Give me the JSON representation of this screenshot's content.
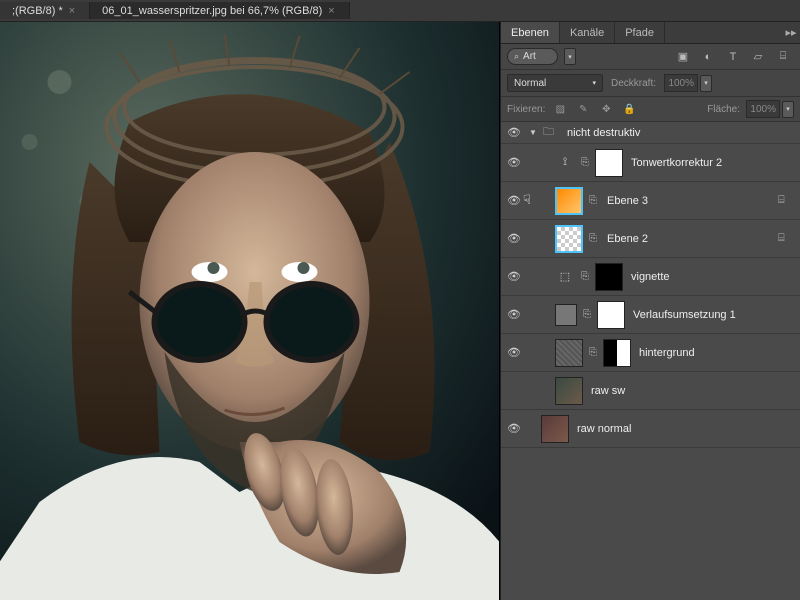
{
  "tabs": [
    {
      "label": ";(RGB/8) *",
      "close": "×",
      "active": false
    },
    {
      "label": "06_01_wasserspritzer.jpg bei 66,7% (RGB/8)",
      "close": "×",
      "active": true
    }
  ],
  "panel": {
    "tabs": {
      "ebenen": "Ebenen",
      "kanaele": "Kanäle",
      "pfade": "Pfade"
    },
    "search": {
      "icon": "⌕",
      "value": "Art"
    },
    "filter_icons": {
      "image": "▣",
      "adjust": "◐",
      "type": "T",
      "shape": "▱",
      "smart": "⌸"
    },
    "blend": {
      "mode": "Normal",
      "opacity_label": "Deckkraft:",
      "opacity_value": "100%"
    },
    "lock": {
      "label": "Fixieren:",
      "fill_label": "Fläche:",
      "fill_value": "100%"
    }
  },
  "group": {
    "name": "nicht destruktiv"
  },
  "layers": [
    {
      "id": "tonwert",
      "name": "Tonwertkorrektur 2",
      "adj_icon": "⟟",
      "mask": "white",
      "linked": true
    },
    {
      "id": "ebene3",
      "name": "Ebene 3",
      "thumb": "orange",
      "linked": true,
      "smart": true,
      "hand": true
    },
    {
      "id": "ebene2",
      "name": "Ebene 2",
      "thumb": "checker",
      "linked": true,
      "smart": true
    },
    {
      "id": "vignette",
      "name": "vignette",
      "adj_icon": "⬚",
      "mask": "black",
      "linked": true
    },
    {
      "id": "verlauf",
      "name": "Verlaufsumsetzung 1",
      "adj_icon": "gray",
      "mask": "white",
      "linked": true
    },
    {
      "id": "hintergrund",
      "name": "hintergrund",
      "thumb": "noise",
      "mask": "bwmask",
      "linked": true
    },
    {
      "id": "rawsw",
      "name": "raw sw",
      "thumb": "photo"
    },
    {
      "id": "rawnormal",
      "name": "raw normal",
      "thumb": "photo2",
      "outside": true
    }
  ]
}
